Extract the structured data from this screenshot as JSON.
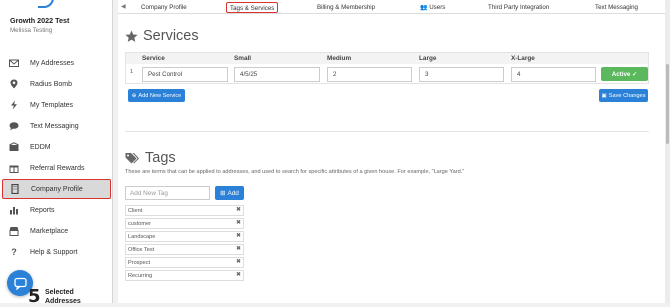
{
  "sidebar": {
    "account_name": "Growth 2022 Test",
    "account_user": "Melissa Testing",
    "items": [
      {
        "label": "My Addresses",
        "icon": "envelope-icon"
      },
      {
        "label": "Radius Bomb",
        "icon": "map-pin-icon"
      },
      {
        "label": "My Templates",
        "icon": "bolt-icon"
      },
      {
        "label": "Text Messaging",
        "icon": "chat-icon"
      },
      {
        "label": "EDDM",
        "icon": "mailbox-icon"
      },
      {
        "label": "Referral Rewards",
        "icon": "gift-icon"
      },
      {
        "label": "Company Profile",
        "icon": "building-icon"
      },
      {
        "label": "Reports",
        "icon": "bar-chart-icon"
      },
      {
        "label": "Marketplace",
        "icon": "store-icon"
      },
      {
        "label": "Help & Support",
        "icon": "question-icon"
      }
    ],
    "active_index": 6,
    "selected_count": "5",
    "selected_label_1": "Selected",
    "selected_label_2": "Addresses"
  },
  "tabs": [
    "Company Profile",
    "Tags & Services",
    "Billing & Membership",
    "Users",
    "Third Party Integration",
    "Text Messaging"
  ],
  "active_tab": "Tags & Services",
  "services": {
    "title": "Services",
    "headers": [
      "Service",
      "Small",
      "Medium",
      "Large",
      "X-Large"
    ],
    "row": {
      "num": "1",
      "service": "Pest Control",
      "small": "4/5/25",
      "medium": "2",
      "large": "3",
      "xlarge": "4",
      "status": "Active"
    },
    "add_button": "Add New Service",
    "save_button": "Save Changes"
  },
  "tags": {
    "title": "Tags",
    "description": "These are terms that can be applied to addresses, and used to search for specific attributes of a given house. For example, \"Large Yard.\"",
    "input_placeholder": "Add New Tag",
    "add_button": "Add",
    "list": [
      "Client",
      "customer",
      "Landscape",
      "Office Test",
      "Prospect",
      "Recurring"
    ]
  },
  "colors": {
    "accent": "#2b80d8",
    "success": "#5cb85c",
    "highlight": "#d8342f"
  }
}
